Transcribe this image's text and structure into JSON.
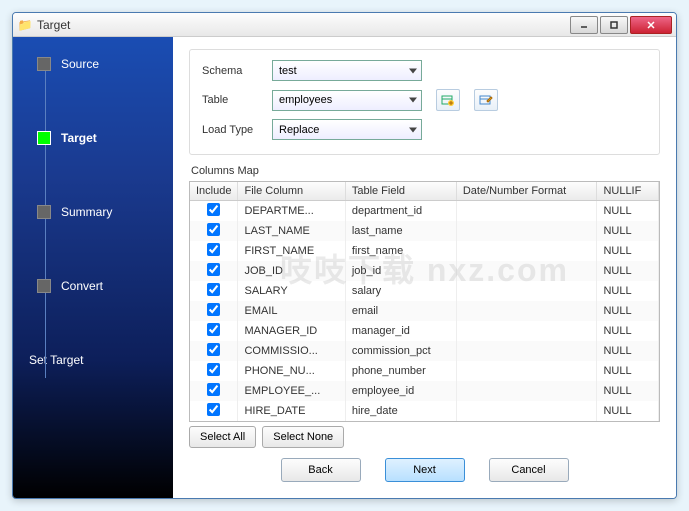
{
  "window": {
    "title": "Target"
  },
  "sidebar": {
    "steps": [
      {
        "label": "Source",
        "active": false
      },
      {
        "label": "Target",
        "active": true
      },
      {
        "label": "Summary",
        "active": false
      },
      {
        "label": "Convert",
        "active": false
      }
    ],
    "setTarget": "Set Target"
  },
  "form": {
    "schemaLabel": "Schema",
    "schemaValue": "test",
    "tableLabel": "Table",
    "tableValue": "employees",
    "loadTypeLabel": "Load Type",
    "loadTypeValue": "Replace"
  },
  "columnsMapLabel": "Columns Map",
  "headers": {
    "include": "Include",
    "fileColumn": "File Column",
    "tableField": "Table Field",
    "dateFormat": "Date/Number Format",
    "nullif": "NULLIF"
  },
  "rows": [
    {
      "include": true,
      "fileColumn": "DEPARTME...",
      "tableField": "department_id",
      "format": "",
      "nullif": "NULL"
    },
    {
      "include": true,
      "fileColumn": "LAST_NAME",
      "tableField": "last_name",
      "format": "",
      "nullif": "NULL"
    },
    {
      "include": true,
      "fileColumn": "FIRST_NAME",
      "tableField": "first_name",
      "format": "",
      "nullif": "NULL"
    },
    {
      "include": true,
      "fileColumn": "JOB_ID",
      "tableField": "job_id",
      "format": "",
      "nullif": "NULL"
    },
    {
      "include": true,
      "fileColumn": "SALARY",
      "tableField": "salary",
      "format": "",
      "nullif": "NULL"
    },
    {
      "include": true,
      "fileColumn": "EMAIL",
      "tableField": "email",
      "format": "",
      "nullif": "NULL"
    },
    {
      "include": true,
      "fileColumn": "MANAGER_ID",
      "tableField": "manager_id",
      "format": "",
      "nullif": "NULL"
    },
    {
      "include": true,
      "fileColumn": "COMMISSIO...",
      "tableField": "commission_pct",
      "format": "",
      "nullif": "NULL"
    },
    {
      "include": true,
      "fileColumn": "PHONE_NU...",
      "tableField": "phone_number",
      "format": "",
      "nullif": "NULL"
    },
    {
      "include": true,
      "fileColumn": "EMPLOYEE_...",
      "tableField": "employee_id",
      "format": "",
      "nullif": "NULL"
    },
    {
      "include": true,
      "fileColumn": "HIRE_DATE",
      "tableField": "hire_date",
      "format": "",
      "nullif": "NULL"
    }
  ],
  "buttons": {
    "selectAll": "Select All",
    "selectNone": "Select None",
    "back": "Back",
    "next": "Next",
    "cancel": "Cancel"
  },
  "watermark": "吱吱下载 nxz.com"
}
